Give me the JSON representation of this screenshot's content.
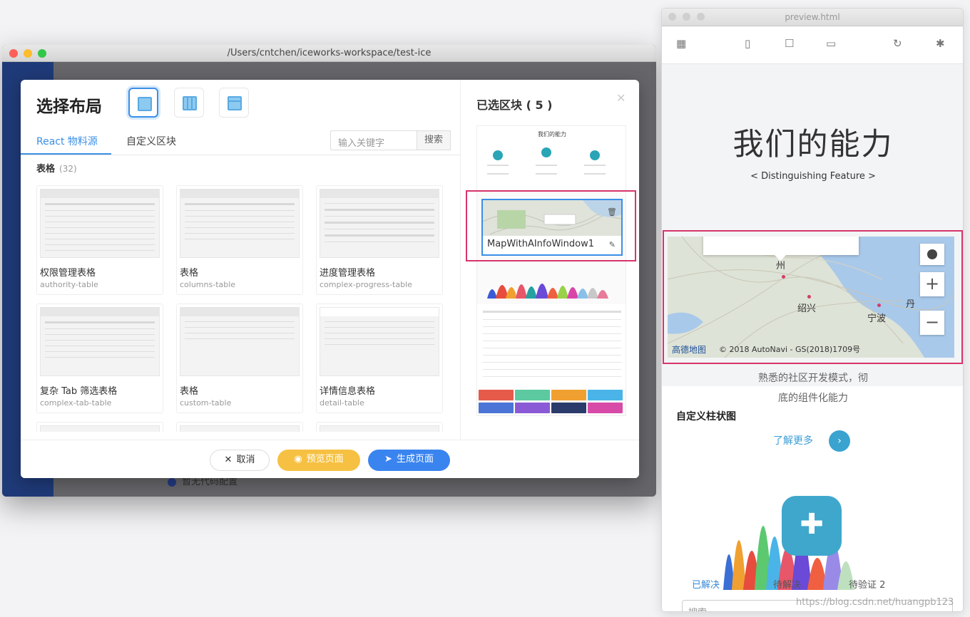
{
  "app_window": {
    "title": "/Users/cntchen/iceworks-workspace/test-ice",
    "footer_text": "暂无代码配置"
  },
  "modal": {
    "title": "选择布局",
    "tabs": [
      "React 物料源",
      "自定义区块"
    ],
    "search": {
      "placeholder": "输入关键字",
      "button": "搜索"
    },
    "category": {
      "name": "表格",
      "count": "(32)"
    },
    "cards": [
      {
        "name": "权限管理表格",
        "id": "authority-table"
      },
      {
        "name": "表格",
        "id": "columns-table"
      },
      {
        "name": "进度管理表格",
        "id": "complex-progress-table"
      },
      {
        "name": "复杂 Tab 筛选表格",
        "id": "complex-tab-table"
      },
      {
        "name": "表格",
        "id": "custom-table"
      },
      {
        "name": "详情信息表格",
        "id": "detail-table"
      }
    ],
    "selected": {
      "title": "已选区块 ( 5 )",
      "block1_title": "我们的能力",
      "map_block_label": "MapWithAInfoWindow1"
    },
    "buttons": {
      "cancel": "取消",
      "preview": "预览页面",
      "generate": "生成页面"
    }
  },
  "preview": {
    "window_title": "preview.html",
    "heading": "我们的能力",
    "subheading": "< Distinguishing Feature >",
    "map": {
      "cities": [
        "州",
        "绍兴",
        "宁波",
        "丹"
      ],
      "logo": "高德地图",
      "attribution": "© 2018 AutoNavi - GS(2018)1709号",
      "zoom_in": "+",
      "zoom_out": "−"
    },
    "text_line1": "熟悉的社区开发模式，彻",
    "text_line2": "底的组件化能力",
    "chart_title": "自定义柱状图",
    "more": "了解更多",
    "stats": [
      "已解决",
      "待解决",
      "待验证 2"
    ],
    "search_placeholder": "搜索"
  },
  "watermark": "https://blog.csdn.net/huangpb123",
  "colors": {
    "accent": "#3b8fe6",
    "highlight": "#d8346a",
    "sidebar": "#1f3a78",
    "preview_btn": "#f6c142",
    "generate_btn": "#3a84f0"
  },
  "icons": [
    "qrcode-icon",
    "mobile-icon",
    "tablet-icon",
    "laptop-icon",
    "refresh-icon",
    "bug-icon",
    "eye-icon",
    "send-icon",
    "close-icon",
    "trash-icon",
    "edit-icon",
    "puzzle-icon"
  ]
}
